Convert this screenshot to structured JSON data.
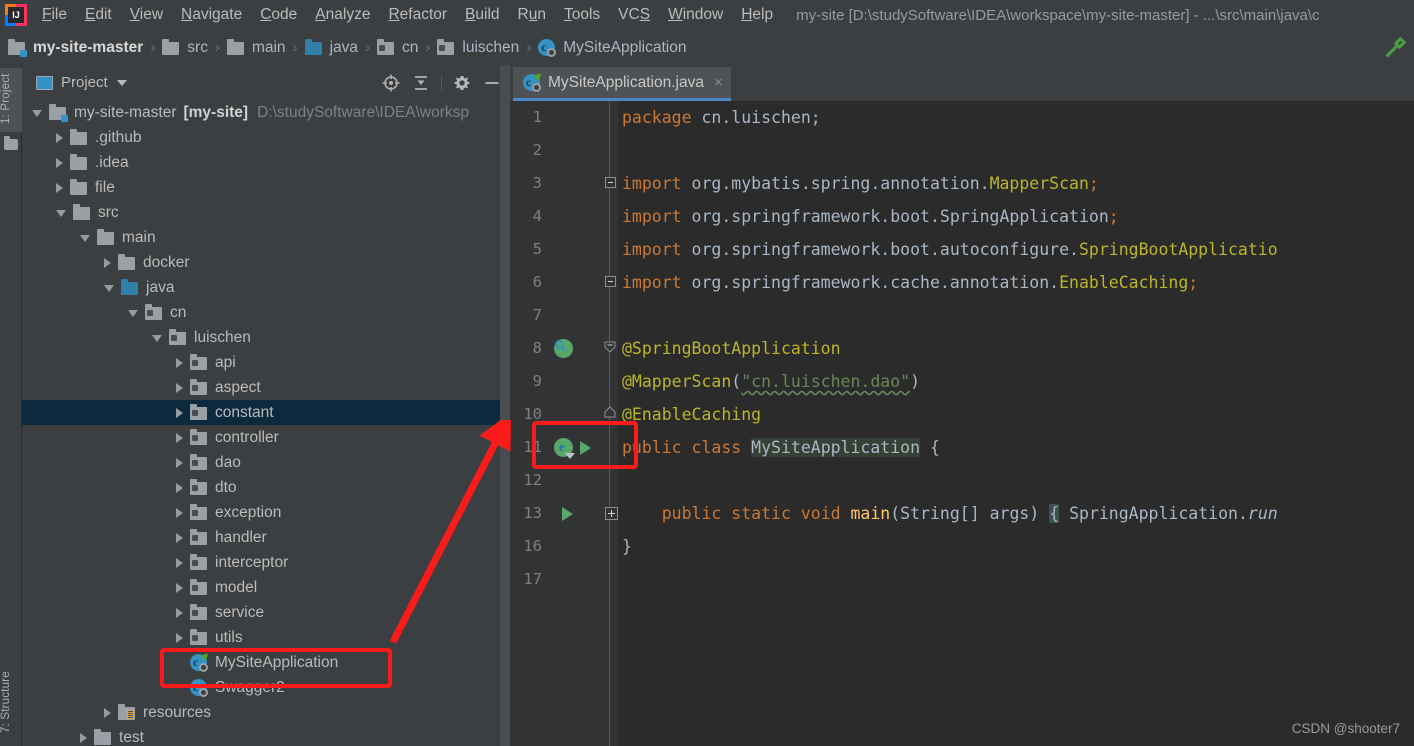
{
  "window": {
    "title": "my-site [D:\\studySoftware\\IDEA\\workspace\\my-site-master] - ...\\src\\main\\java\\c",
    "logo_text": "IJ"
  },
  "menubar": {
    "items": [
      {
        "label": "File",
        "mnemonic": "F"
      },
      {
        "label": "Edit",
        "mnemonic": "E"
      },
      {
        "label": "View",
        "mnemonic": "V"
      },
      {
        "label": "Navigate",
        "mnemonic": "N"
      },
      {
        "label": "Code",
        "mnemonic": "C"
      },
      {
        "label": "Analyze",
        "mnemonic": "A"
      },
      {
        "label": "Refactor",
        "mnemonic": "R"
      },
      {
        "label": "Build",
        "mnemonic": "B"
      },
      {
        "label": "Run",
        "mnemonic": "u"
      },
      {
        "label": "Tools",
        "mnemonic": "T"
      },
      {
        "label": "VCS",
        "mnemonic": "S"
      },
      {
        "label": "Window",
        "mnemonic": "W"
      },
      {
        "label": "Help",
        "mnemonic": "H"
      }
    ]
  },
  "navbar": {
    "crumbs": [
      {
        "label": "my-site-master",
        "icon": "module-folder-icon",
        "bold": true
      },
      {
        "label": "src",
        "icon": "folder-icon",
        "bold": false
      },
      {
        "label": "main",
        "icon": "folder-icon",
        "bold": false
      },
      {
        "label": "java",
        "icon": "source-folder-icon",
        "bold": false
      },
      {
        "label": "cn",
        "icon": "package-folder-icon",
        "bold": false
      },
      {
        "label": "luischen",
        "icon": "package-folder-icon",
        "bold": false
      },
      {
        "label": "MySiteApplication",
        "icon": "java-class-icon",
        "bold": false
      }
    ],
    "separator": "›",
    "build_icon": "hammer-icon"
  },
  "rail": {
    "project_button": "1: Project",
    "structure_button": "7: Structure"
  },
  "project_panel": {
    "title": "Project",
    "actions": [
      {
        "name": "locate-icon",
        "glyph": "⊕"
      },
      {
        "name": "collapse-all-icon",
        "glyph": "⩥"
      },
      {
        "name": "settings-gear-icon",
        "glyph": "⚙"
      },
      {
        "name": "hide-panel-icon",
        "glyph": "−"
      }
    ],
    "tree": [
      {
        "label": "my-site-master",
        "suffix": "[my-site]",
        "path": "D:\\studySoftware\\IDEA\\worksp",
        "indent": 0,
        "state": "open",
        "icon": "module-folder-icon",
        "selected": false,
        "boxed": false
      },
      {
        "label": ".github",
        "indent": 1,
        "state": "closed",
        "icon": "folder-icon",
        "selected": false,
        "boxed": false
      },
      {
        "label": ".idea",
        "indent": 1,
        "state": "closed",
        "icon": "folder-icon",
        "selected": false,
        "boxed": false
      },
      {
        "label": "file",
        "indent": 1,
        "state": "closed",
        "icon": "folder-icon",
        "selected": false,
        "boxed": false
      },
      {
        "label": "src",
        "indent": 1,
        "state": "open",
        "icon": "folder-icon",
        "selected": false,
        "boxed": false
      },
      {
        "label": "main",
        "indent": 2,
        "state": "open",
        "icon": "folder-icon",
        "selected": false,
        "boxed": false
      },
      {
        "label": "docker",
        "indent": 3,
        "state": "closed",
        "icon": "folder-icon",
        "selected": false,
        "boxed": false
      },
      {
        "label": "java",
        "indent": 3,
        "state": "open",
        "icon": "source-folder-icon",
        "selected": false,
        "boxed": false
      },
      {
        "label": "cn",
        "indent": 4,
        "state": "open",
        "icon": "package-folder-icon",
        "selected": false,
        "boxed": false
      },
      {
        "label": "luischen",
        "indent": 5,
        "state": "open",
        "icon": "package-folder-icon",
        "selected": false,
        "boxed": false
      },
      {
        "label": "api",
        "indent": 6,
        "state": "closed",
        "icon": "package-folder-icon",
        "selected": false,
        "boxed": false
      },
      {
        "label": "aspect",
        "indent": 6,
        "state": "closed",
        "icon": "package-folder-icon",
        "selected": false,
        "boxed": false
      },
      {
        "label": "constant",
        "indent": 6,
        "state": "closed",
        "icon": "package-folder-icon",
        "selected": true,
        "boxed": false
      },
      {
        "label": "controller",
        "indent": 6,
        "state": "closed",
        "icon": "package-folder-icon",
        "selected": false,
        "boxed": false
      },
      {
        "label": "dao",
        "indent": 6,
        "state": "closed",
        "icon": "package-folder-icon",
        "selected": false,
        "boxed": false
      },
      {
        "label": "dto",
        "indent": 6,
        "state": "closed",
        "icon": "package-folder-icon",
        "selected": false,
        "boxed": false
      },
      {
        "label": "exception",
        "indent": 6,
        "state": "closed",
        "icon": "package-folder-icon",
        "selected": false,
        "boxed": false
      },
      {
        "label": "handler",
        "indent": 6,
        "state": "closed",
        "icon": "package-folder-icon",
        "selected": false,
        "boxed": false
      },
      {
        "label": "interceptor",
        "indent": 6,
        "state": "closed",
        "icon": "package-folder-icon",
        "selected": false,
        "boxed": false
      },
      {
        "label": "model",
        "indent": 6,
        "state": "closed",
        "icon": "package-folder-icon",
        "selected": false,
        "boxed": false
      },
      {
        "label": "service",
        "indent": 6,
        "state": "closed",
        "icon": "package-folder-icon",
        "selected": false,
        "boxed": false
      },
      {
        "label": "utils",
        "indent": 6,
        "state": "closed",
        "icon": "package-folder-icon",
        "selected": false,
        "boxed": false
      },
      {
        "label": "MySiteApplication",
        "indent": 6,
        "state": "leaf",
        "icon": "spring-class-icon",
        "selected": false,
        "boxed": true
      },
      {
        "label": "Swagger2",
        "indent": 6,
        "state": "leaf",
        "icon": "java-class-icon",
        "selected": false,
        "boxed": false
      },
      {
        "label": "resources",
        "indent": 3,
        "state": "closed",
        "icon": "resource-folder-icon",
        "selected": false,
        "boxed": false
      },
      {
        "label": "test",
        "indent": 2,
        "state": "closed",
        "icon": "folder-icon",
        "selected": false,
        "boxed": false
      }
    ]
  },
  "editor": {
    "tab": {
      "label": "MySiteApplication.java",
      "icon": "java-class-icon",
      "close": "×"
    },
    "lines": [
      {
        "num": "1",
        "gutter": "",
        "fold": "",
        "tokens": [
          {
            "t": "package ",
            "c": "kw"
          },
          {
            "t": "cn.luischen;",
            "c": "plain"
          }
        ]
      },
      {
        "num": "2",
        "gutter": "",
        "fold": "",
        "tokens": []
      },
      {
        "num": "3",
        "gutter": "",
        "fold": "fold-start",
        "tokens": [
          {
            "t": "import ",
            "c": "kw"
          },
          {
            "t": "org.mybatis.spring.annotation.",
            "c": "plain"
          },
          {
            "t": "MapperScan",
            "c": "ann"
          },
          {
            "t": ";",
            "c": "kw"
          }
        ]
      },
      {
        "num": "4",
        "gutter": "",
        "fold": "",
        "tokens": [
          {
            "t": "import ",
            "c": "kw"
          },
          {
            "t": "org.springframework.boot.SpringApplication",
            "c": "plain"
          },
          {
            "t": ";",
            "c": "kw"
          }
        ]
      },
      {
        "num": "5",
        "gutter": "",
        "fold": "",
        "tokens": [
          {
            "t": "import ",
            "c": "kw"
          },
          {
            "t": "org.springframework.boot.autoconfigure.",
            "c": "plain"
          },
          {
            "t": "SpringBootApplicatio",
            "c": "ann"
          }
        ]
      },
      {
        "num": "6",
        "gutter": "",
        "fold": "fold-end",
        "tokens": [
          {
            "t": "import ",
            "c": "kw"
          },
          {
            "t": "org.springframework.cache.annotation.",
            "c": "plain"
          },
          {
            "t": "EnableCaching",
            "c": "ann"
          },
          {
            "t": ";",
            "c": "kw"
          }
        ]
      },
      {
        "num": "7",
        "gutter": "",
        "fold": "",
        "tokens": []
      },
      {
        "num": "8",
        "gutter": "spring-bean-icon",
        "fold": "fold-caret-start",
        "tokens": [
          {
            "t": "@SpringBootApplication",
            "c": "ann"
          }
        ]
      },
      {
        "num": "9",
        "gutter": "",
        "fold": "",
        "tokens": [
          {
            "t": "@MapperScan",
            "c": "ann"
          },
          {
            "t": "(",
            "c": "plain"
          },
          {
            "t": "\"cn.luischen.dao\"",
            "c": "str wav"
          },
          {
            "t": ")",
            "c": "plain"
          }
        ]
      },
      {
        "num": "10",
        "gutter": "",
        "fold": "fold-caret-end",
        "tokens": [
          {
            "t": "@EnableCaching",
            "c": "ann"
          }
        ]
      },
      {
        "num": "11",
        "gutter": "spring-run-icons",
        "fold": "",
        "tokens": [
          {
            "t": "public ",
            "c": "kw"
          },
          {
            "t": "class ",
            "c": "kw"
          },
          {
            "t": "MySiteApplication",
            "c": "cls-name"
          },
          {
            "t": " {",
            "c": "plain"
          }
        ]
      },
      {
        "num": "12",
        "gutter": "",
        "fold": "",
        "tokens": []
      },
      {
        "num": "13",
        "gutter": "run-icon",
        "fold": "fold-plus",
        "tokens": [
          {
            "t": "    public ",
            "c": "kw"
          },
          {
            "t": "static ",
            "c": "kw"
          },
          {
            "t": "void ",
            "c": "kw"
          },
          {
            "t": "main",
            "c": "mth"
          },
          {
            "t": "(String[] args) ",
            "c": "plain"
          },
          {
            "t": "{",
            "c": "brace-hl"
          },
          {
            "t": " SpringApplication.",
            "c": "plain"
          },
          {
            "t": "run",
            "c": "ital"
          }
        ]
      },
      {
        "num": "16",
        "gutter": "",
        "fold": "",
        "tokens": [
          {
            "t": "}",
            "c": "plain"
          }
        ]
      },
      {
        "num": "17",
        "gutter": "",
        "fold": "",
        "tokens": []
      }
    ]
  },
  "annotations": {
    "red_box_tree": {
      "label": "highlight-my-site-application-file"
    },
    "red_box_gutter": {
      "label": "highlight-run-gutter-icons"
    },
    "red_arrow": {
      "label": "pointer-arrow"
    }
  },
  "watermark": "CSDN @shooter7"
}
